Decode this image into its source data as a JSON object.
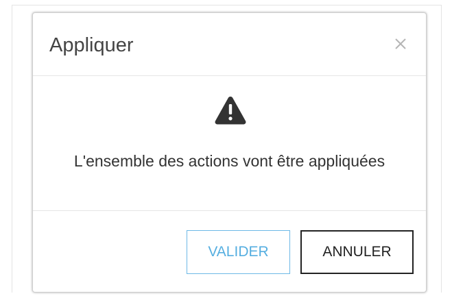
{
  "dialog": {
    "title": "Appliquer",
    "message": "L'ensemble des actions vont être appliquées",
    "buttons": {
      "validate_label": "VALIDER",
      "cancel_label": "ANNULER"
    },
    "icons": {
      "close": "close-icon",
      "warning": "warning-icon"
    },
    "colors": {
      "validate_accent": "#55aee0",
      "cancel_border": "#222222",
      "warning_icon": "#333333",
      "title_text": "#444444"
    }
  }
}
